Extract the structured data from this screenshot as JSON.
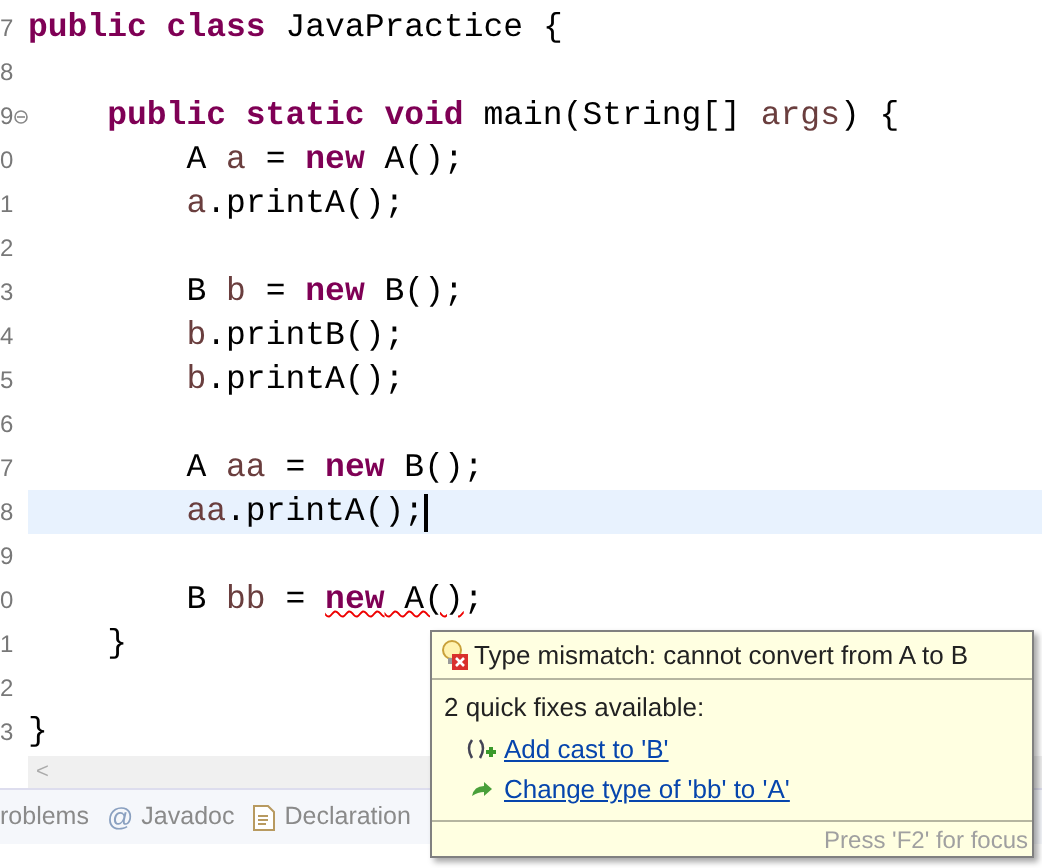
{
  "editor": {
    "lines": [
      {
        "number": "7",
        "tokens": [
          {
            "kind": "keyword",
            "text": "public class"
          },
          {
            "kind": "plain",
            "text": " JavaPractice {"
          }
        ],
        "children": [
          {
            "number": "8"
          },
          {
            "number": "9",
            "fold": true,
            "tokens": [
              {
                "kind": "keyword",
                "text": "public static void"
              },
              {
                "kind": "plain",
                "text": " main(String[] "
              },
              {
                "kind": "local",
                "text": "args"
              },
              {
                "kind": "plain",
                "text": ") {"
              }
            ],
            "children": [
              {
                "number": "0",
                "tokens": [
                  {
                    "kind": "plain",
                    "text": "A "
                  },
                  {
                    "kind": "local",
                    "text": "a"
                  },
                  {
                    "kind": "plain",
                    "text": " = "
                  },
                  {
                    "kind": "keyword",
                    "text": "new"
                  },
                  {
                    "kind": "plain",
                    "text": " A();"
                  }
                ]
              },
              {
                "number": "1",
                "tokens": [
                  {
                    "kind": "local",
                    "text": "a"
                  },
                  {
                    "kind": "plain",
                    "text": ".printA();"
                  }
                ]
              },
              {
                "number": "2"
              },
              {
                "number": "3",
                "tokens": [
                  {
                    "kind": "plain",
                    "text": "B "
                  },
                  {
                    "kind": "local",
                    "text": "b"
                  },
                  {
                    "kind": "plain",
                    "text": " = "
                  },
                  {
                    "kind": "keyword",
                    "text": "new"
                  },
                  {
                    "kind": "plain",
                    "text": " B();"
                  }
                ]
              },
              {
                "number": "4",
                "tokens": [
                  {
                    "kind": "local",
                    "text": "b"
                  },
                  {
                    "kind": "plain",
                    "text": ".printB();"
                  }
                ]
              },
              {
                "number": "5",
                "tokens": [
                  {
                    "kind": "local",
                    "text": "b"
                  },
                  {
                    "kind": "plain",
                    "text": ".printA();"
                  }
                ]
              },
              {
                "number": "6"
              },
              {
                "number": "7",
                "tokens": [
                  {
                    "kind": "plain",
                    "text": "A "
                  },
                  {
                    "kind": "local",
                    "text": "aa"
                  },
                  {
                    "kind": "plain",
                    "text": " = "
                  },
                  {
                    "kind": "keyword",
                    "text": "new"
                  },
                  {
                    "kind": "plain",
                    "text": " B();"
                  }
                ]
              },
              {
                "number": "8",
                "current": true,
                "tokens": [
                  {
                    "kind": "local",
                    "text": "aa"
                  },
                  {
                    "kind": "plain",
                    "text": ".printA();"
                  }
                ]
              },
              {
                "number": "9"
              },
              {
                "number": "0",
                "tokens": [
                  {
                    "kind": "plain",
                    "text": "B "
                  },
                  {
                    "kind": "local",
                    "text": "bb"
                  },
                  {
                    "kind": "plain",
                    "text": " = "
                  },
                  {
                    "kind": "error_keyword",
                    "text": "new"
                  },
                  {
                    "kind": "error",
                    "text": " A()"
                  },
                  {
                    "kind": "plain",
                    "text": ";"
                  }
                ]
              }
            ]
          },
          {
            "number": "1",
            "tokens": [
              {
                "kind": "plain",
                "text": "}"
              }
            ]
          },
          {
            "number": "2"
          }
        ]
      },
      {
        "number": "3",
        "tokens": [
          {
            "kind": "plain",
            "text": "}"
          }
        ]
      }
    ]
  },
  "scrollbar": {
    "left_arrow": "<"
  },
  "quick_fix_popup": {
    "message": "Type mismatch: cannot convert from A to B",
    "summary": "2 quick fixes available:",
    "fixes": [
      {
        "kind": "cast",
        "label": "Add cast to 'B'"
      },
      {
        "kind": "change",
        "label": "Change type of 'bb' to 'A'"
      }
    ],
    "hint": "Press 'F2' for focus"
  },
  "bottom_tabs": [
    {
      "kind": "plain",
      "label": "roblems"
    },
    {
      "kind": "at",
      "icon": "@",
      "label": "Javadoc"
    },
    {
      "kind": "doc",
      "label": "Declaration"
    }
  ]
}
